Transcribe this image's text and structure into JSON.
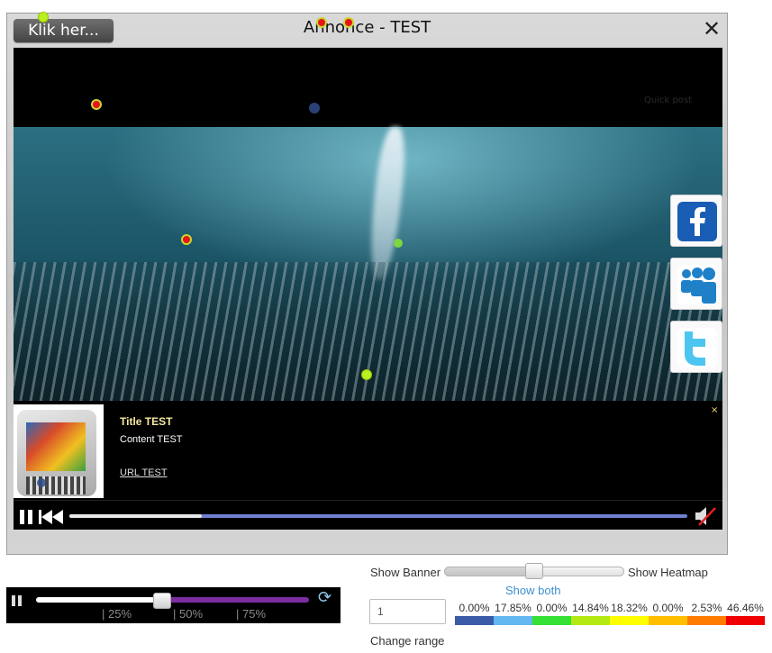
{
  "ad": {
    "title": "Annonce - TEST",
    "cta_label": "Klik her...",
    "close_glyph": "✕",
    "quick_post": "Quick post",
    "info": {
      "title": "Title TEST",
      "content": "Content TEST",
      "url": "URL TEST",
      "close_glyph": "×"
    },
    "share": [
      {
        "name": "facebook",
        "icon": "facebook-icon",
        "color": "#1a5db4"
      },
      {
        "name": "myspace",
        "icon": "myspace-icon",
        "color": "#1f80c8"
      },
      {
        "name": "twitter",
        "icon": "twitter-icon",
        "color": "#4cc6f0"
      }
    ],
    "progress_played": 0.215
  },
  "timeline": {
    "progress": 0.37,
    "ticks": [
      "| 25%",
      "| 50%",
      "| 75%"
    ]
  },
  "heatmap": {
    "left_label": "Show Banner",
    "right_label": "Show Heatmap",
    "mode_label": "Show both",
    "range_value": "1",
    "range_label": "Change range",
    "legend": [
      {
        "value": "0.00%",
        "color": "#3b5ba8"
      },
      {
        "value": "17.85%",
        "color": "#62b8ef"
      },
      {
        "value": "0.00%",
        "color": "#35e135"
      },
      {
        "value": "14.84%",
        "color": "#b4ea12"
      },
      {
        "value": "18.32%",
        "color": "#fefe00"
      },
      {
        "value": "0.00%",
        "color": "#ffbe00"
      },
      {
        "value": "2.53%",
        "color": "#ff7b00"
      },
      {
        "value": "46.46%",
        "color": "#f00000"
      }
    ]
  }
}
